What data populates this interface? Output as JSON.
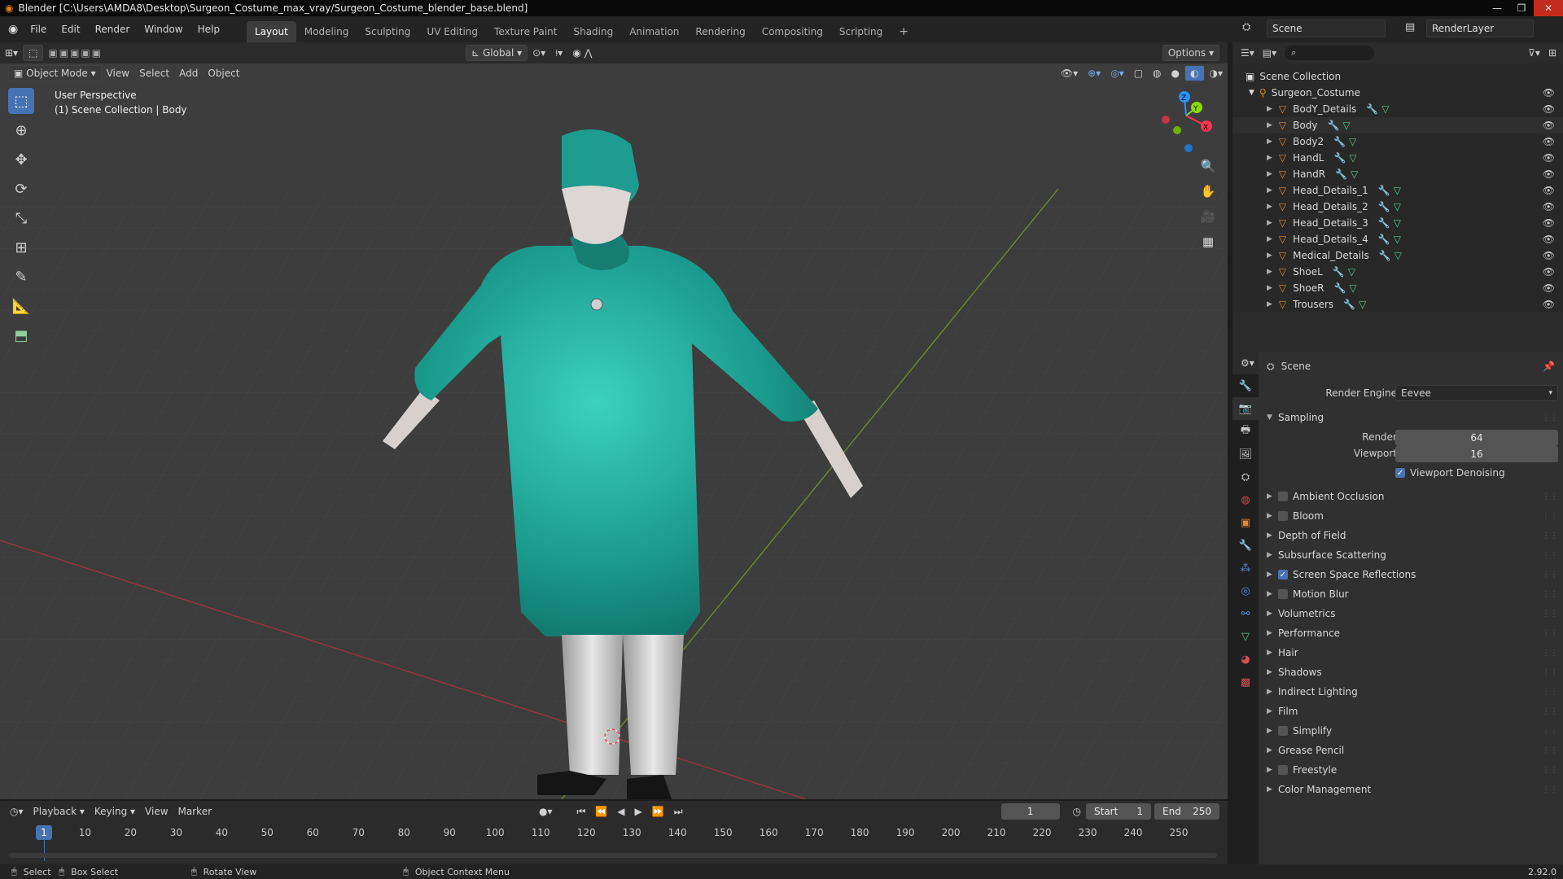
{
  "window": {
    "title": "Blender [C:\\Users\\AMDA8\\Desktop\\Surgeon_Costume_max_vray/Surgeon_Costume_blender_base.blend]",
    "controls": [
      "—",
      "❐",
      "✕"
    ]
  },
  "menubar": {
    "menus": [
      "File",
      "Edit",
      "Render",
      "Window",
      "Help"
    ],
    "workspaces": [
      "Layout",
      "Modeling",
      "Sculpting",
      "UV Editing",
      "Texture Paint",
      "Shading",
      "Animation",
      "Rendering",
      "Compositing",
      "Scripting"
    ],
    "active_workspace": "Layout",
    "add_tab": "+",
    "scene": "Scene",
    "render_layer": "RenderLayer"
  },
  "viewport_header": {
    "mode": "Object Mode",
    "menus": [
      "View",
      "Select",
      "Add",
      "Object"
    ],
    "orientation": "Global",
    "options": "Options"
  },
  "viewport": {
    "perspective": "User Perspective",
    "collection_info": "(1) Scene Collection | Body",
    "gizmo_axes": [
      "X",
      "Y",
      "Z"
    ]
  },
  "outliner": {
    "root": "Scene Collection",
    "collection": "Surgeon_Costume",
    "objects": [
      "BodY_Details",
      "Body",
      "Body2",
      "HandL",
      "HandR",
      "Head_Details_1",
      "Head_Details_2",
      "Head_Details_3",
      "Head_Details_4",
      "Medical_Details",
      "ShoeL",
      "ShoeR",
      "Trousers"
    ]
  },
  "properties": {
    "context": "Scene",
    "render_engine_label": "Render Engine",
    "render_engine": "Eevee",
    "sampling": {
      "title": "Sampling",
      "render_label": "Render",
      "render_value": "64",
      "viewport_label": "Viewport",
      "viewport_value": "16",
      "denoise_label": "Viewport Denoising",
      "denoise_checked": true
    },
    "sections": [
      {
        "label": "Ambient Occlusion",
        "checkbox": true,
        "checked": false
      },
      {
        "label": "Bloom",
        "checkbox": true,
        "checked": false
      },
      {
        "label": "Depth of Field",
        "checkbox": false
      },
      {
        "label": "Subsurface Scattering",
        "checkbox": false
      },
      {
        "label": "Screen Space Reflections",
        "checkbox": true,
        "checked": true
      },
      {
        "label": "Motion Blur",
        "checkbox": true,
        "checked": false
      },
      {
        "label": "Volumetrics",
        "checkbox": false
      },
      {
        "label": "Performance",
        "checkbox": false
      },
      {
        "label": "Hair",
        "checkbox": false
      },
      {
        "label": "Shadows",
        "checkbox": false
      },
      {
        "label": "Indirect Lighting",
        "checkbox": false
      },
      {
        "label": "Film",
        "checkbox": false
      },
      {
        "label": "Simplify",
        "checkbox": true,
        "checked": false
      },
      {
        "label": "Grease Pencil",
        "checkbox": false
      },
      {
        "label": "Freestyle",
        "checkbox": true,
        "checked": false
      },
      {
        "label": "Color Management",
        "checkbox": false
      }
    ]
  },
  "timeline": {
    "menus": [
      "Playback",
      "Keying",
      "View",
      "Marker"
    ],
    "current_frame": "1",
    "start_label": "Start",
    "start": "1",
    "end_label": "End",
    "end": "250",
    "ticks": [
      "10",
      "20",
      "30",
      "40",
      "50",
      "60",
      "70",
      "80",
      "90",
      "100",
      "110",
      "120",
      "130",
      "140",
      "150",
      "160",
      "170",
      "180",
      "190",
      "200",
      "210",
      "220",
      "230",
      "240",
      "250"
    ]
  },
  "statusbar": {
    "select": "Select",
    "box_select": "Box Select",
    "rotate_view": "Rotate View",
    "context_menu": "Object Context Menu",
    "version": "2.92.0"
  },
  "colors": {
    "accent": "#4772b3",
    "object_orange": "#e7862b",
    "mesh_green": "#5fc68a",
    "x_axis": "#ff3352",
    "y_axis": "#8bdc00",
    "z_axis": "#2890ff",
    "gown": "#1e9e92"
  }
}
